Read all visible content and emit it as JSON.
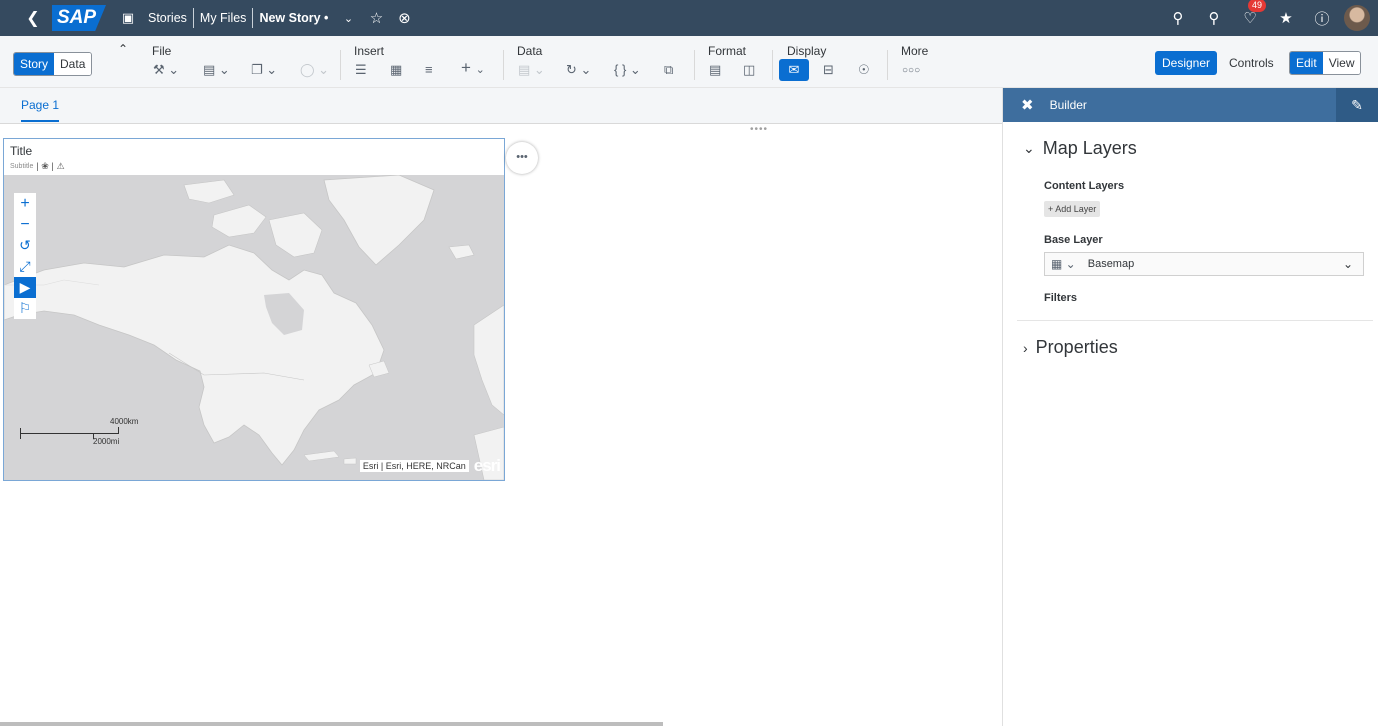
{
  "shell": {
    "logo": "SAP",
    "back_icon": "back-icon",
    "stories": "Stories",
    "my_files": "My Files",
    "story_title": "New Story",
    "notifications_count": "49"
  },
  "toolbar": {
    "story_tab": "Story",
    "data_tab": "Data",
    "file": "File",
    "insert": "Insert",
    "data": "Data",
    "format": "Format",
    "display": "Display",
    "more": "More",
    "designer": "Designer",
    "controls": "Controls",
    "edit": "Edit",
    "view": "View"
  },
  "pages": {
    "tab1": "Page 1"
  },
  "widget": {
    "title": "Title",
    "subtitle": "Subtitle",
    "scale_km": "4000km",
    "scale_mi": "2000mi",
    "attribution": "Esri | Esri, HERE, NRCan",
    "esri_logo": "esri",
    "more": "•••"
  },
  "panel": {
    "title": "Builder",
    "map_layers": "Map Layers",
    "content_layers": "Content Layers",
    "add_layer": "+ Add Layer",
    "base_layer": "Base Layer",
    "basemap": "Basemap",
    "filters": "Filters",
    "properties": "Properties"
  },
  "colors": {
    "shell_bg": "#354a5f",
    "accent": "#0a6ed1",
    "panel_header": "#3e6e9e",
    "map_land": "#f2f2f2",
    "map_water": "#d4d4d6"
  }
}
